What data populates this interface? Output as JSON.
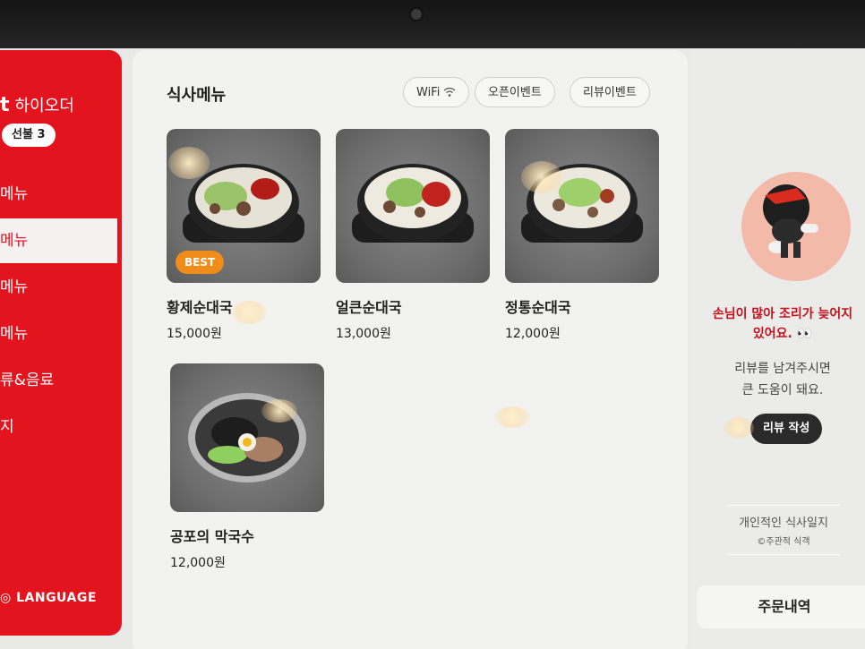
{
  "sidebar": {
    "brand_logo": "t",
    "brand_name": "하이오더",
    "prepay_badge": "선불 3",
    "items": [
      {
        "label": "메뉴"
      },
      {
        "label": "메뉴"
      },
      {
        "label": "메뉴"
      },
      {
        "label": "메뉴"
      },
      {
        "label": "류&음료"
      },
      {
        "label": "지"
      }
    ],
    "language": "LANGUAGE",
    "accent_color": "#e3141e"
  },
  "main": {
    "section_title": "식사메뉴",
    "pills": [
      "WiFi",
      "오픈이벤트",
      "리뷰이벤트"
    ],
    "menu_items": [
      {
        "name": "황제순대국",
        "price": "15,000원",
        "badge": "BEST",
        "image": "sundae-gukbap-with-chili-paste"
      },
      {
        "name": "얼큰순대국",
        "price": "13,000원",
        "image": "spicy-sundae-gukbap"
      },
      {
        "name": "정통순대국",
        "price": "12,000원",
        "image": "sundae-gukbap"
      },
      {
        "name": "공포의 막국수",
        "price": "12,000원",
        "image": "makguksu-cold-noodles"
      }
    ],
    "badge_color": "#f08c1a"
  },
  "right_panel": {
    "notice_red": "손님이 많아 조리가 늦어지",
    "notice_red_line2": "있어요. 👀",
    "notice_gray_line1": "리뷰를 남겨주시면",
    "notice_gray_line2": "큰 도움이 돼요.",
    "review_button": "리뷰 작성",
    "watermark_line1": "개인적인 식사일지",
    "watermark_line2": "©주관적 식객",
    "order_history": "주문내역"
  }
}
